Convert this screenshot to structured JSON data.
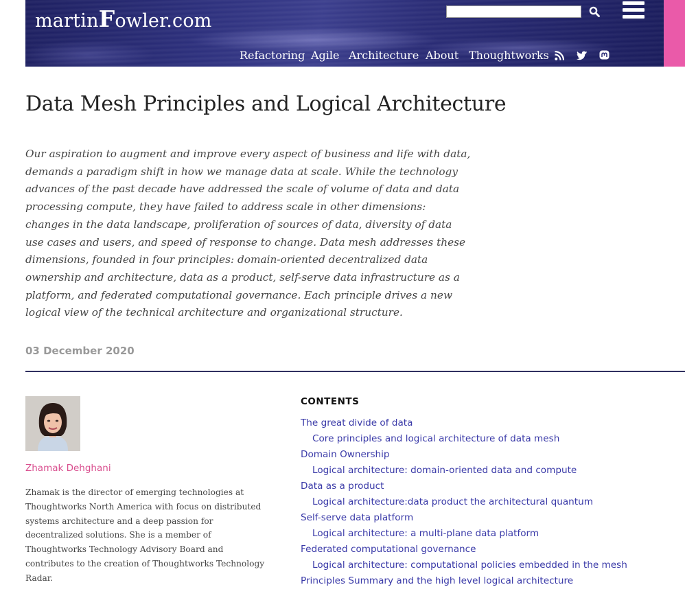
{
  "site": {
    "logo_prefix": "martin",
    "logo_big_letter": "F",
    "logo_suffix": "owler.com",
    "search_placeholder": "",
    "colors": {
      "banner": "#2a2c76",
      "accent_pink": "#ea5aa9",
      "link": "#3a3aa8",
      "author": "#d94f8f"
    }
  },
  "nav": {
    "items": [
      "Refactoring",
      "Agile",
      "Architecture",
      "About",
      "Thoughtworks"
    ],
    "social_icons": [
      "rss-icon",
      "twitter-icon",
      "mastodon-icon"
    ]
  },
  "article": {
    "title": "Data Mesh Principles and Logical Architecture",
    "abstract": "Our aspiration to augment and improve every aspect of business and life with data, demands a paradigm shift in how we manage data at scale. While the technology advances of the past decade have addressed the scale of volume of data and data processing compute, they have failed to address scale in other dimensions: changes in the data landscape, proliferation of sources of data, diversity of data use cases and users, and speed of response to change. Data mesh addresses these dimensions, founded in four principles: domain-oriented decentralized data ownership and architecture, data as a product, self-serve data infrastructure as a platform, and federated computational governance. Each principle drives a new logical view of the technical architecture and organizational structure.",
    "date": "03 December 2020"
  },
  "author": {
    "name": "Zhamak Dehghani",
    "bio": "Zhamak is the director of emerging technologies at Thoughtworks North America with focus on distributed systems architecture and a deep passion for decentralized solutions. She is a member of Thoughtworks Technology Advisory Board and contributes to the creation of Thoughtworks Technology Radar."
  },
  "contents": {
    "heading": "CONTENTS",
    "items": [
      {
        "label": "The great divide of data",
        "level": 1
      },
      {
        "label": "Core principles and logical architecture of data mesh",
        "level": 2
      },
      {
        "label": "Domain Ownership",
        "level": 1
      },
      {
        "label": "Logical architecture: domain-oriented data and compute",
        "level": 2
      },
      {
        "label": "Data as a product",
        "level": 1
      },
      {
        "label": "Logical architecture:data product the architectural quantum",
        "level": 2
      },
      {
        "label": "Self-serve data platform",
        "level": 1
      },
      {
        "label": "Logical architecture: a multi-plane data platform",
        "level": 2
      },
      {
        "label": "Federated computational governance",
        "level": 1
      },
      {
        "label": "Logical architecture: computational policies embedded in the mesh",
        "level": 2
      },
      {
        "label": "Principles Summary and the high level logical architecture",
        "level": 1
      }
    ]
  }
}
